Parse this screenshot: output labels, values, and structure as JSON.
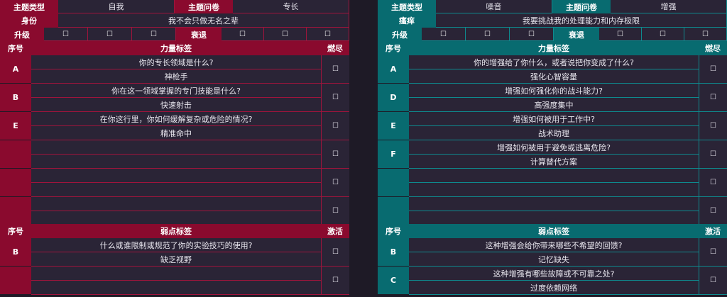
{
  "left": {
    "row1": {
      "theme_type_label": "主题类型",
      "theme_type": "自我",
      "theme_q_label": "主题问卷",
      "theme_q": "专长"
    },
    "row2": {
      "label": "身份",
      "value": "我不会只做无名之辈"
    },
    "row3": {
      "upgrade_label": "升级",
      "decline_label": "衰退",
      "box": "☐"
    },
    "power": {
      "id_header": "序号",
      "title": "力量标签",
      "burn": "燃尽",
      "items": [
        {
          "id": "A",
          "q": "你的专长领域是什么?",
          "a": "神枪手"
        },
        {
          "id": "B",
          "q": "你在这一领域掌握的专门技能是什么?",
          "a": "快速射击"
        },
        {
          "id": "E",
          "q": "在你这行里，你如何缓解复杂或危险的情况?",
          "a": "精准命中"
        },
        {
          "id": "",
          "q": "",
          "a": ""
        },
        {
          "id": "",
          "q": "",
          "a": ""
        },
        {
          "id": "",
          "q": "",
          "a": ""
        }
      ]
    },
    "weak": {
      "id_header": "序号",
      "title": "弱点标签",
      "burn": "激活",
      "items": [
        {
          "id": "B",
          "q": "什么或谁限制或规范了你的实验技巧的使用?",
          "a": "缺乏视野"
        },
        {
          "id": "",
          "q": "",
          "a": ""
        }
      ]
    }
  },
  "right": {
    "row1": {
      "theme_type_label": "主题类型",
      "theme_type": "噪音",
      "theme_q_label": "主题问卷",
      "theme_q": "增强"
    },
    "row2": {
      "label": "瘙痒",
      "value": "我要挑战我的处理能力和内存极限"
    },
    "row3": {
      "upgrade_label": "升级",
      "decline_label": "衰退",
      "box": "☐"
    },
    "power": {
      "id_header": "序号",
      "title": "力量标签",
      "burn": "燃尽",
      "items": [
        {
          "id": "A",
          "q": "你的增强给了你什么，或者说把你变成了什么?",
          "a": "强化心智容量"
        },
        {
          "id": "D",
          "q": "增强如何强化你的战斗能力?",
          "a": "高强度集中"
        },
        {
          "id": "E",
          "q": "增强如何被用于工作中?",
          "a": "战术助理"
        },
        {
          "id": "F",
          "q": "增强如何被用于避免或逃离危险?",
          "a": "计算替代方案"
        },
        {
          "id": "",
          "q": "",
          "a": ""
        },
        {
          "id": "",
          "q": "",
          "a": ""
        }
      ]
    },
    "weak": {
      "id_header": "序号",
      "title": "弱点标签",
      "burn": "激活",
      "items": [
        {
          "id": "B",
          "q": "这种增强会给你带来哪些不希望的回馈?",
          "a": "记忆缺失"
        },
        {
          "id": "C",
          "q": "这种增强有哪些故障或不可靠之处?",
          "a": "过度依赖网络"
        }
      ]
    }
  },
  "colors": {
    "left_accent": "#8a0a2e",
    "right_accent": "#086b70",
    "background": "#1e1a26"
  }
}
